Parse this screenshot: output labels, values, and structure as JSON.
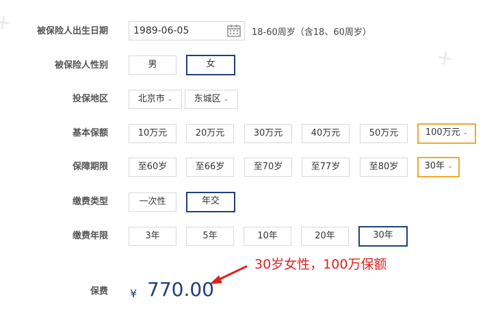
{
  "birth": {
    "label": "被保险人出生日期",
    "value": "1989-06-05",
    "hint": "18-60周岁（含18、60周岁）"
  },
  "gender": {
    "label": "被保险人性别",
    "options": [
      "男",
      "女"
    ],
    "selected": "女"
  },
  "region": {
    "label": "投保地区",
    "city": "北京市",
    "district": "东城区"
  },
  "coverage": {
    "label": "基本保额",
    "options": [
      "10万元",
      "20万元",
      "30万元",
      "40万元",
      "50万元",
      "100万元"
    ],
    "selected": "100万元"
  },
  "period": {
    "label": "保障期限",
    "options": [
      "至60岁",
      "至66岁",
      "至70岁",
      "至77岁",
      "至80岁",
      "30年"
    ],
    "selected": "30年"
  },
  "pay_type": {
    "label": "缴费类型",
    "options": [
      "一次性",
      "年交"
    ],
    "selected": "年交"
  },
  "pay_years": {
    "label": "缴费年限",
    "options": [
      "3年",
      "5年",
      "10年",
      "20年",
      "30年"
    ],
    "selected": "30年"
  },
  "premium": {
    "label": "保费",
    "currency": "¥",
    "value": "770.00"
  },
  "annotation": "30岁女性，100万保额",
  "colors": {
    "selected_border": "#1f3f7a",
    "dropdown_selected_border": "#f0a92a",
    "annotation": "#e02020",
    "price": "#1f3f7a"
  }
}
